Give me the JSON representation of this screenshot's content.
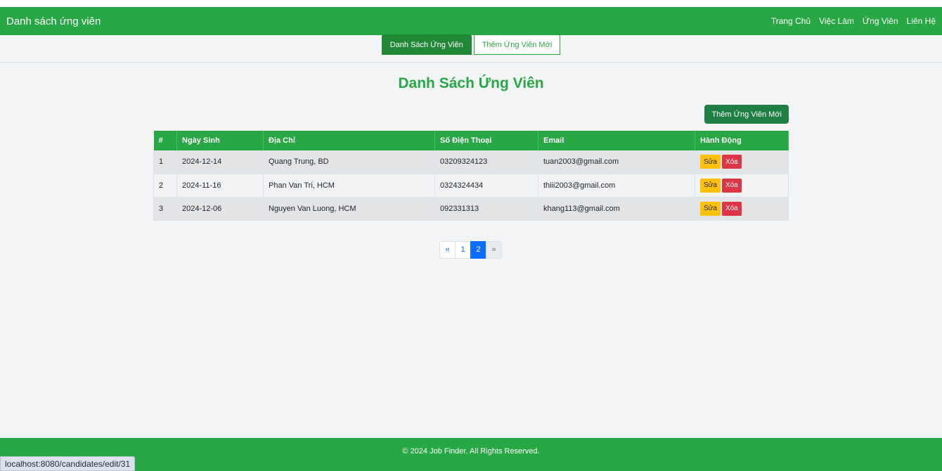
{
  "navbar": {
    "brand": "Danh sách ứng viên",
    "links": [
      "Trang Chủ",
      "Việc Làm",
      "Ứng Viên",
      "Liên Hệ"
    ]
  },
  "tabs": [
    {
      "label": "Danh Sách Ứng Viên",
      "active": true
    },
    {
      "label": "Thêm Ứng Viên Mới",
      "active": false
    }
  ],
  "page_title": "Danh Sách Ứng Viên",
  "add_button": "Thêm Ứng Viên Mới",
  "table": {
    "headers": [
      "#",
      "Ngày Sinh",
      "Địa Chỉ",
      "Số Điện Thoại",
      "Email",
      "Hành Động"
    ],
    "rows": [
      {
        "num": "1",
        "dob": "2024-12-14",
        "address": "Quang Trung, BD",
        "phone": "03209324123",
        "email": "tuan2003@gmail.com"
      },
      {
        "num": "2",
        "dob": "2024-11-16",
        "address": "Phan Van Tri, HCM",
        "phone": "0324324434",
        "email": "thiii2003@gmail.com"
      },
      {
        "num": "3",
        "dob": "2024-12-06",
        "address": "Nguyen Van Luong, HCM",
        "phone": "092331313",
        "email": "khang113@gmail.com"
      }
    ],
    "edit_label": "Sửa",
    "delete_label": "Xóa"
  },
  "pagination": {
    "prev": "«",
    "pages": [
      "1",
      "2"
    ],
    "current": "2",
    "next": "»"
  },
  "footer": "© 2024 Job Finder. All Rights Reserved.",
  "status_url": "localhost:8080/candidates/edit/31",
  "colors": {
    "primary_green": "#28a745",
    "dark_green": "#1e7e44",
    "edit": "#ffc107",
    "delete": "#dc3545",
    "page_active": "#0d6efd"
  }
}
